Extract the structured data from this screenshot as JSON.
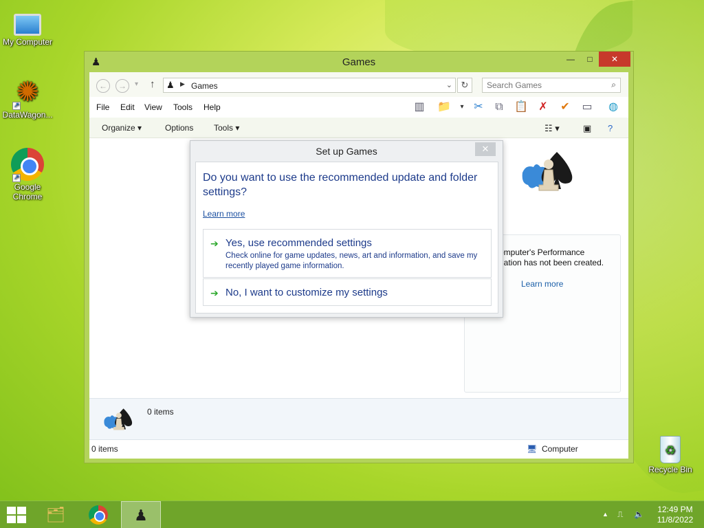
{
  "desktop": {
    "icons": [
      {
        "label": "My Computer",
        "icon": "computer-icon"
      },
      {
        "label": "DataWagon...",
        "icon": "mandala-icon"
      },
      {
        "label": "Google Chrome",
        "icon": "chrome-icon"
      },
      {
        "label": "Recycle Bin",
        "icon": "recycle-bin-icon"
      }
    ]
  },
  "window": {
    "title": "Games",
    "minimize": "—",
    "maximize": "□",
    "close": "✕",
    "address": {
      "crumb": "Games"
    },
    "search": {
      "placeholder": "Search Games"
    },
    "menu": [
      "File",
      "Edit",
      "View",
      "Tools",
      "Help"
    ],
    "commands": {
      "organize": "Organize ▾",
      "options": "Options",
      "tools": "Tools ▾"
    },
    "side_panel": {
      "text": "omputer's Performance\nnation has not been created.",
      "link": "Learn more"
    },
    "details": {
      "count": "0 items"
    },
    "status": {
      "left": "0 items",
      "right": "Computer"
    }
  },
  "dialog": {
    "title": "Set up Games",
    "close": "✕",
    "question": "Do you want to use the recommended update and folder settings?",
    "learn_more": "Learn more",
    "option1": {
      "title": "Yes, use recommended settings",
      "desc": "Check online for game updates, news, art and information, and save my recently played game information."
    },
    "option2": {
      "title": "No, I want to customize my settings"
    }
  },
  "taskbar": {
    "time": "12:49 PM",
    "date": "11/8/2022"
  },
  "colors": {
    "window_frame": "#b3d35a",
    "close_button": "#c7392b",
    "taskbar": "#6fa52a",
    "link": "#1b5fa8",
    "dialog_text": "#1c3a8a"
  }
}
